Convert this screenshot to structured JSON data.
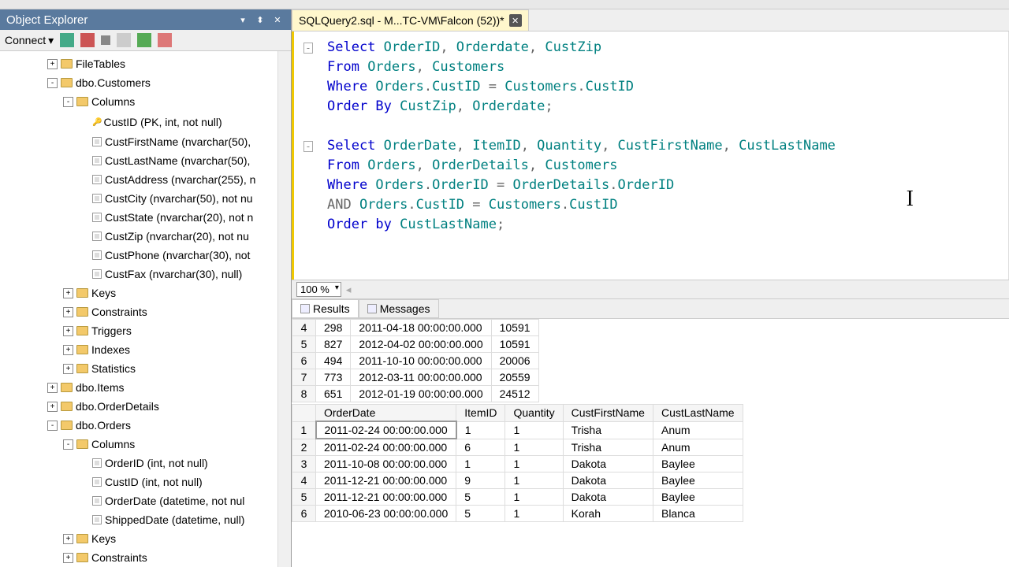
{
  "explorer": {
    "title": "Object Explorer",
    "connect": "Connect",
    "tree": [
      {
        "indent": 60,
        "exp": "+",
        "icon": "folder",
        "label": "FileTables"
      },
      {
        "indent": 60,
        "exp": "-",
        "icon": "folder",
        "label": "dbo.Customers"
      },
      {
        "indent": 80,
        "exp": "-",
        "icon": "folder",
        "label": "Columns"
      },
      {
        "indent": 100,
        "exp": "",
        "icon": "key",
        "label": "CustID (PK, int, not null)"
      },
      {
        "indent": 100,
        "exp": "",
        "icon": "col",
        "label": "CustFirstName (nvarchar(50),"
      },
      {
        "indent": 100,
        "exp": "",
        "icon": "col",
        "label": "CustLastName (nvarchar(50),"
      },
      {
        "indent": 100,
        "exp": "",
        "icon": "col",
        "label": "CustAddress (nvarchar(255), n"
      },
      {
        "indent": 100,
        "exp": "",
        "icon": "col",
        "label": "CustCity (nvarchar(50), not nu"
      },
      {
        "indent": 100,
        "exp": "",
        "icon": "col",
        "label": "CustState (nvarchar(20), not n"
      },
      {
        "indent": 100,
        "exp": "",
        "icon": "col",
        "label": "CustZip (nvarchar(20), not nu"
      },
      {
        "indent": 100,
        "exp": "",
        "icon": "col",
        "label": "CustPhone (nvarchar(30), not"
      },
      {
        "indent": 100,
        "exp": "",
        "icon": "col",
        "label": "CustFax (nvarchar(30), null)"
      },
      {
        "indent": 80,
        "exp": "+",
        "icon": "folder",
        "label": "Keys"
      },
      {
        "indent": 80,
        "exp": "+",
        "icon": "folder",
        "label": "Constraints"
      },
      {
        "indent": 80,
        "exp": "+",
        "icon": "folder",
        "label": "Triggers"
      },
      {
        "indent": 80,
        "exp": "+",
        "icon": "folder",
        "label": "Indexes"
      },
      {
        "indent": 80,
        "exp": "+",
        "icon": "folder",
        "label": "Statistics"
      },
      {
        "indent": 60,
        "exp": "+",
        "icon": "folder",
        "label": "dbo.Items"
      },
      {
        "indent": 60,
        "exp": "+",
        "icon": "folder",
        "label": "dbo.OrderDetails"
      },
      {
        "indent": 60,
        "exp": "-",
        "icon": "folder",
        "label": "dbo.Orders"
      },
      {
        "indent": 80,
        "exp": "-",
        "icon": "folder",
        "label": "Columns"
      },
      {
        "indent": 100,
        "exp": "",
        "icon": "col",
        "label": "OrderID (int, not null)"
      },
      {
        "indent": 100,
        "exp": "",
        "icon": "col",
        "label": "CustID (int, not null)"
      },
      {
        "indent": 100,
        "exp": "",
        "icon": "col",
        "label": "OrderDate (datetime, not nul"
      },
      {
        "indent": 100,
        "exp": "",
        "icon": "col",
        "label": "ShippedDate (datetime, null)"
      },
      {
        "indent": 80,
        "exp": "+",
        "icon": "folder",
        "label": "Keys"
      },
      {
        "indent": 80,
        "exp": "+",
        "icon": "folder",
        "label": "Constraints"
      }
    ]
  },
  "tab": {
    "title": "SQLQuery2.sql - M...TC-VM\\Falcon (52))*"
  },
  "zoom": "100 %",
  "results_tabs": {
    "results": "Results",
    "messages": "Messages"
  },
  "grid1": {
    "rows": [
      {
        "n": "4",
        "c1": "298",
        "c2": "2011-04-18 00:00:00.000",
        "c3": "10591"
      },
      {
        "n": "5",
        "c1": "827",
        "c2": "2012-04-02 00:00:00.000",
        "c3": "10591"
      },
      {
        "n": "6",
        "c1": "494",
        "c2": "2011-10-10 00:00:00.000",
        "c3": "20006"
      },
      {
        "n": "7",
        "c1": "773",
        "c2": "2012-03-11 00:00:00.000",
        "c3": "20559"
      },
      {
        "n": "8",
        "c1": "651",
        "c2": "2012-01-19 00:00:00.000",
        "c3": "24512"
      }
    ]
  },
  "grid2": {
    "headers": [
      "OrderDate",
      "ItemID",
      "Quantity",
      "CustFirstName",
      "CustLastName"
    ],
    "rows": [
      {
        "n": "1",
        "c": [
          "2011-02-24 00:00:00.000",
          "1",
          "1",
          "Trisha",
          "Anum"
        ]
      },
      {
        "n": "2",
        "c": [
          "2011-02-24 00:00:00.000",
          "6",
          "1",
          "Trisha",
          "Anum"
        ]
      },
      {
        "n": "3",
        "c": [
          "2011-10-08 00:00:00.000",
          "1",
          "1",
          "Dakota",
          "Baylee"
        ]
      },
      {
        "n": "4",
        "c": [
          "2011-12-21 00:00:00.000",
          "9",
          "1",
          "Dakota",
          "Baylee"
        ]
      },
      {
        "n": "5",
        "c": [
          "2011-12-21 00:00:00.000",
          "5",
          "1",
          "Dakota",
          "Baylee"
        ]
      },
      {
        "n": "6",
        "c": [
          "2010-06-23 00:00:00.000",
          "5",
          "1",
          "Korah",
          "Blanca"
        ]
      }
    ]
  },
  "sql": {
    "q1": {
      "l1a": "Select",
      "l1b": " OrderID",
      "l1c": ",",
      "l1d": " Orderdate",
      "l1e": ",",
      "l1f": " CustZip",
      "l2a": "From",
      "l2b": " Orders",
      "l2c": ",",
      "l2d": " Customers",
      "l3a": "Where",
      "l3b": " Orders",
      "l3c": ".",
      "l3d": "CustID",
      "l3e": " =",
      "l3f": " Customers",
      "l3g": ".",
      "l3h": "CustID",
      "l4a": "Order",
      "l4b": " By",
      "l4c": " CustZip",
      "l4d": ",",
      "l4e": " Orderdate",
      "l4f": ";"
    },
    "q2": {
      "l1a": "Select",
      "l1b": " OrderDate",
      "l1c": ",",
      "l1d": " ItemID",
      "l1e": ",",
      "l1f": " Quantity",
      "l1g": ",",
      "l1h": " CustFirstName",
      "l1i": ",",
      "l1j": " CustLastName",
      "l2a": "From",
      "l2b": " Orders",
      "l2c": ",",
      "l2d": " OrderDetails",
      "l2e": ",",
      "l2f": " Customers",
      "l3a": "Where",
      "l3b": " Orders",
      "l3c": ".",
      "l3d": "OrderID",
      "l3e": " =",
      "l3f": " OrderDetails",
      "l3g": ".",
      "l3h": "OrderID",
      "l4a": "AND",
      "l4b": " Orders",
      "l4c": ".",
      "l4d": "CustID",
      "l4e": " =",
      "l4f": " Customers",
      "l4g": ".",
      "l4h": "CustID",
      "l5a": "Order",
      "l5b": " by",
      "l5c": " CustLastName",
      "l5d": ";"
    }
  }
}
